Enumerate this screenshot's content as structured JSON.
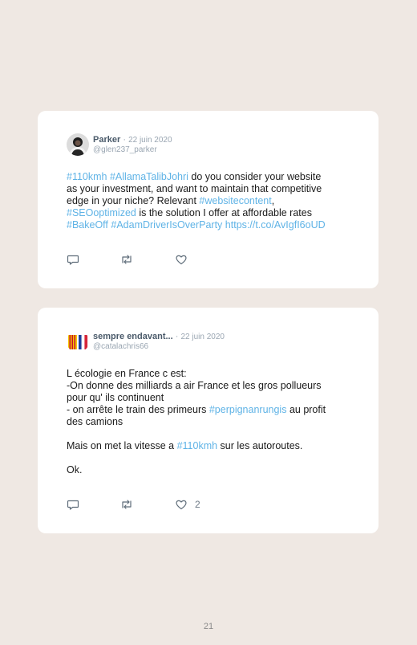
{
  "tweets": [
    {
      "author": "Parker",
      "separator": "·",
      "date": "22 juin 2020",
      "handle": "@glen237_parker",
      "text": {
        "l1_tag1": "#110kmh",
        "l1_tag2": "#AllamaTalibJohri",
        "l1_text": " do you consider your website",
        "l2": "as your investment, and want to maintain that competitive",
        "l3_text": "edge in your niche? Relevant ",
        "l3_tag": "#websitecontent",
        "l3_end": ",",
        "l4_tag": "#SEOoptimized",
        "l4_text": " is the solution I offer at affordable rates",
        "l5_tag1": "#BakeOff",
        "l5_tag2": "#AdamDriverIsOverParty",
        "l5_link": "https://t.co/AvIgfI6oUD"
      },
      "like_count": ""
    },
    {
      "author": "sempre endavant...",
      "separator": "·",
      "date": "22 juin 2020",
      "handle": "@catalachris66",
      "text": {
        "p1_l1": "L écologie en France c est:",
        "p1_l2": "-On donne des milliards a air France et les gros pollueurs",
        "p1_l3": "pour qu' ils continuent",
        "p1_l4_text": "- on arrête le train des primeurs ",
        "p1_l4_tag": "#perpignanrungis",
        "p1_l4_end": " au profit",
        "p1_l5": "des camions",
        "p2_text": "Mais on met la vitesse a ",
        "p2_tag": "#110kmh",
        "p2_end": " sur les autoroutes.",
        "p3": "Ok."
      },
      "like_count": "2"
    }
  ],
  "icons": {
    "reply": "reply-icon",
    "retweet": "retweet-icon",
    "like": "heart-icon"
  },
  "colors": {
    "background": "#efe8e3",
    "hashtag": "#5fb3e6",
    "meta": "#9aa6b2"
  },
  "page_number": "21"
}
